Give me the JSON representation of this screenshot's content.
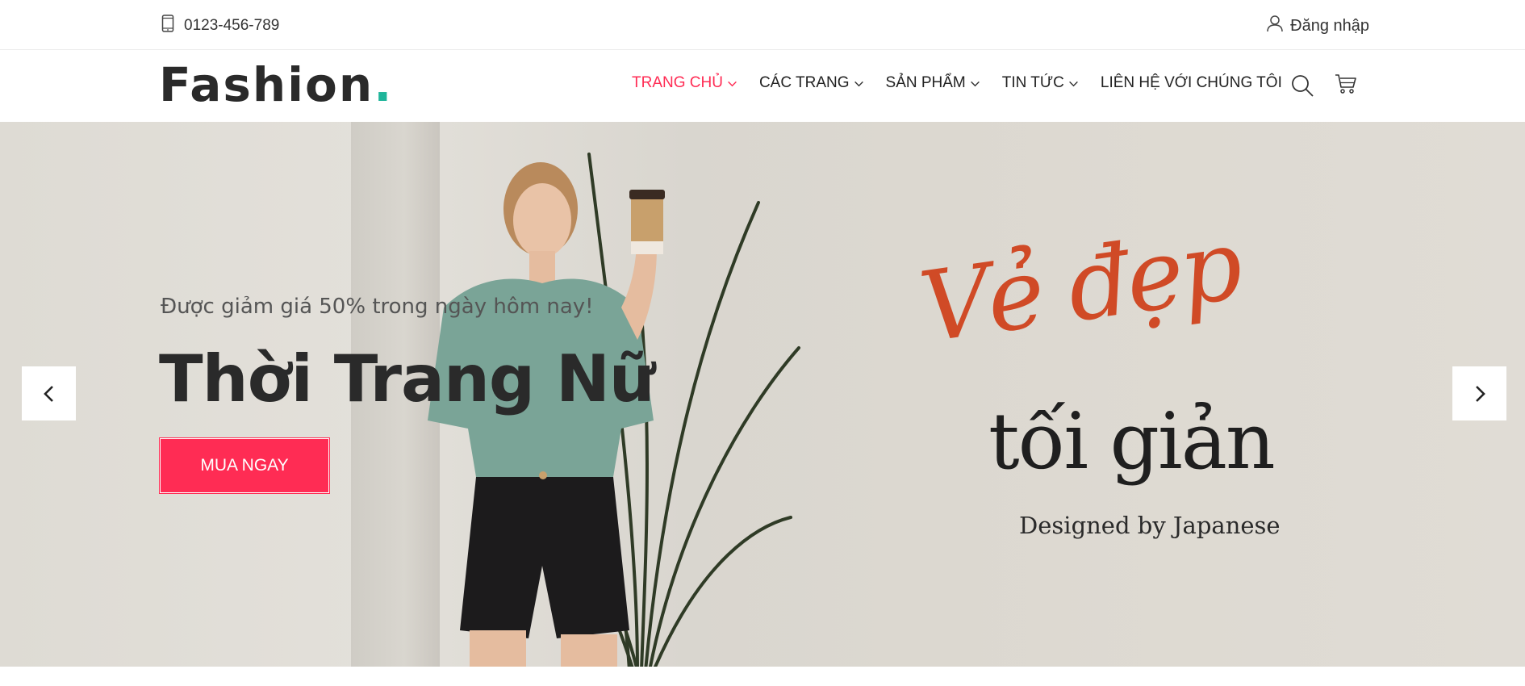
{
  "topbar": {
    "phone_icon": "phone-icon",
    "phone": "0123-456-789",
    "login_icon": "user-icon",
    "login": "Đăng nhập"
  },
  "header": {
    "logo_text": "Fashion",
    "logo_dot": ".",
    "nav": [
      {
        "label": "TRANG CHỦ",
        "active": true
      },
      {
        "label": "CÁC TRANG"
      },
      {
        "label": "SẢN PHẨM"
      },
      {
        "label": "TIN TỨC"
      },
      {
        "label": "LIÊN HỆ VỚI CHÚNG TÔI"
      }
    ],
    "search_icon": "search-icon",
    "cart_icon": "cart-icon"
  },
  "hero": {
    "subtitle": "Được giảm giá 50% trong ngày hôm nay!",
    "title": "Thời Trang Nữ",
    "cta": "MUA NGAY",
    "graphic_script": "Vẻ đẹp",
    "graphic_main": "tối giản",
    "graphic_caption": "Designed by Japanese",
    "prev_icon": "chevron-left-icon",
    "next_icon": "chevron-right-icon"
  },
  "colors": {
    "accent": "#ff2c54",
    "logo_dot": "#1fb59a",
    "script_text": "#d04a26"
  }
}
